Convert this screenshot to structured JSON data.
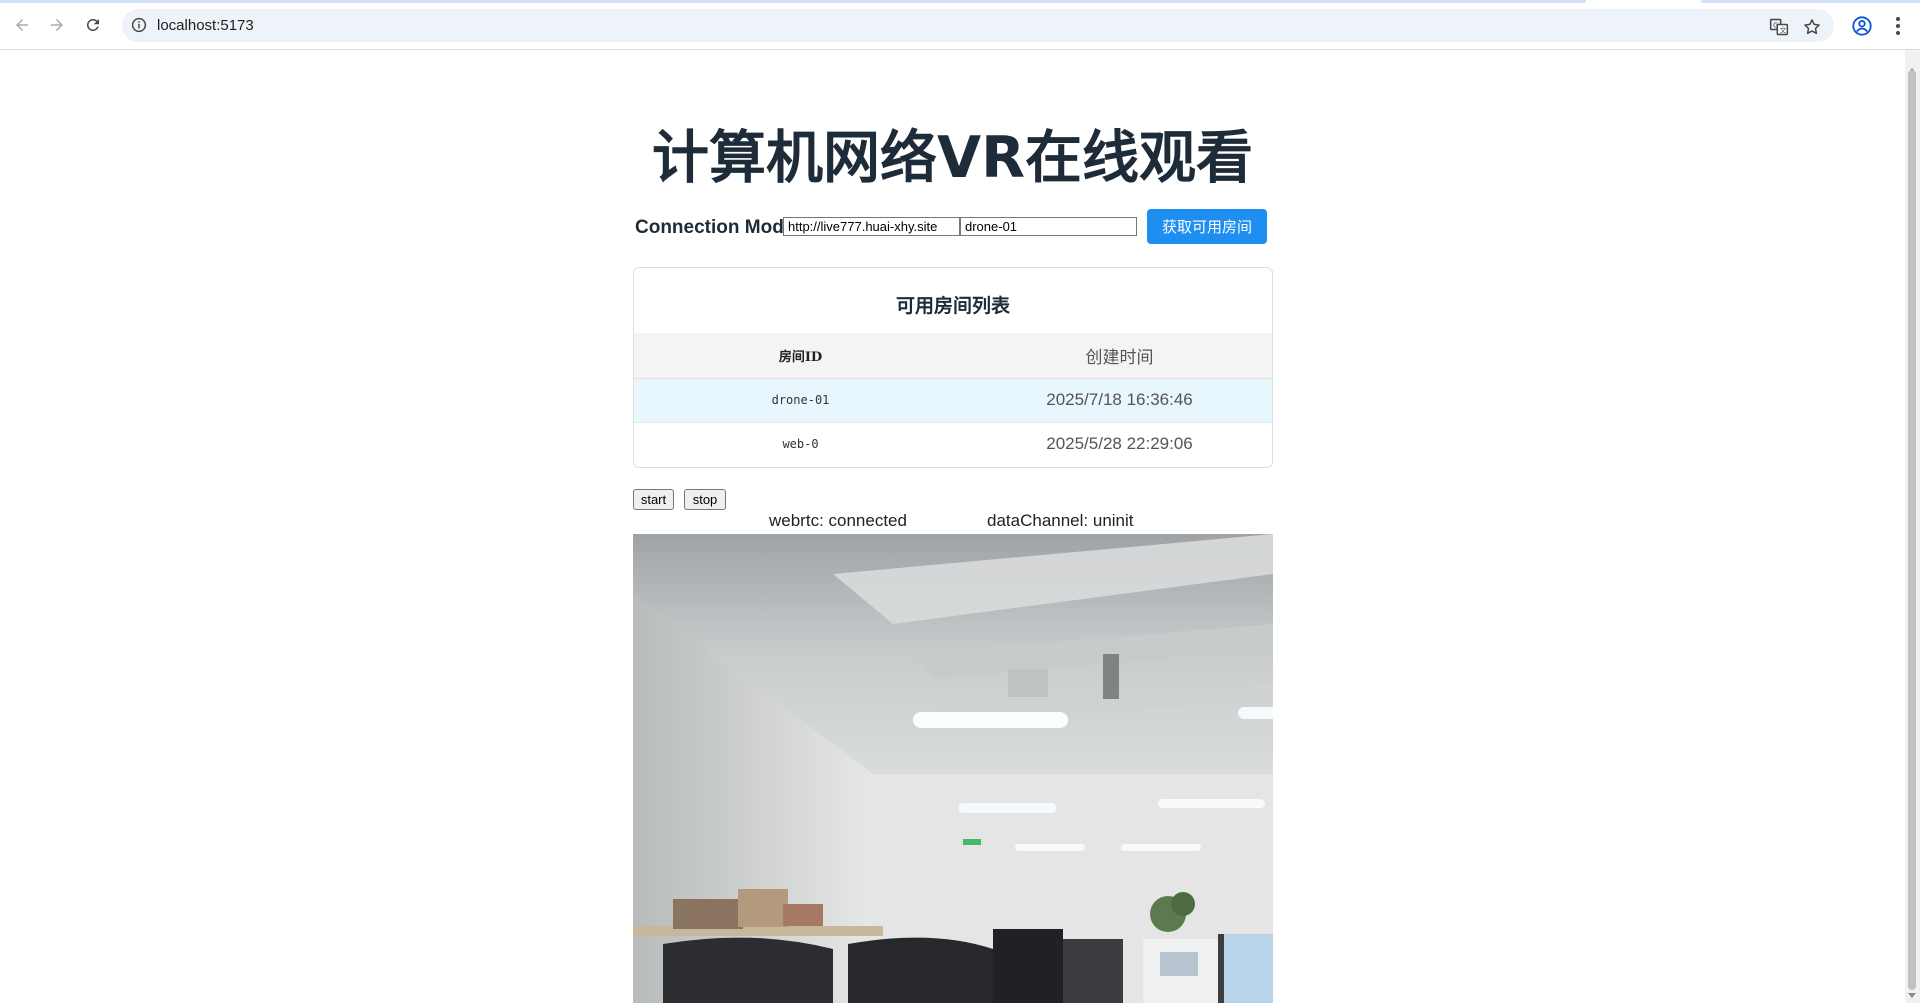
{
  "browser": {
    "url": "localhost:5173",
    "icons": [
      "back-icon",
      "forward-icon",
      "reload-icon",
      "site-info-icon",
      "translate-icon",
      "bookmark-star-icon",
      "profile-icon",
      "menu-kebab-icon"
    ]
  },
  "page": {
    "title": "计算机网络VR在线观看",
    "connection": {
      "label": "Connection Mode",
      "server_value": "http://live777.huai-xhy.site",
      "room_value": "drone-01",
      "fetch_button": "获取可用房间"
    },
    "room_list": {
      "heading": "可用房间列表",
      "columns": [
        "房间ID",
        "创建时间"
      ],
      "rows": [
        {
          "id": "drone-01",
          "created": "2025/7/18 16:36:46",
          "selected": true
        },
        {
          "id": "web-0",
          "created": "2025/5/28 22:29:06",
          "selected": false
        }
      ]
    },
    "controls": {
      "start_label": "start",
      "stop_label": "stop"
    },
    "status": {
      "webrtc": "webrtc: connected",
      "data_channel": "dataChannel: uninit"
    }
  },
  "colors": {
    "accent": "#1f8ef1",
    "title": "#1e2b38",
    "selected_row": "#e8f6fd",
    "header_row": "#f4f4f4"
  }
}
